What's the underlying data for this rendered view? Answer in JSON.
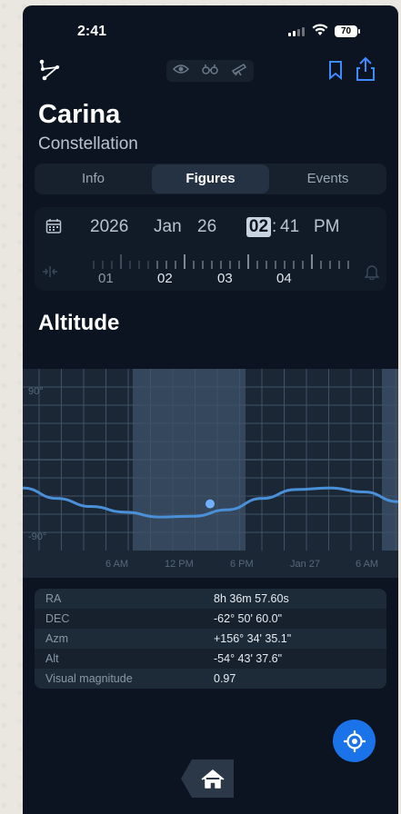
{
  "status": {
    "time": "2:41",
    "battery": "70"
  },
  "object": {
    "name": "Carina",
    "type": "Constellation"
  },
  "view_modes": [
    "eye-icon",
    "binoculars-icon",
    "telescope-icon"
  ],
  "tabs": [
    {
      "label": "Info",
      "active": false
    },
    {
      "label": "Figures",
      "active": true
    },
    {
      "label": "Events",
      "active": false
    }
  ],
  "datetime": {
    "year": "2026",
    "month": "Jan",
    "day": "26",
    "hour": "02",
    "minute": "41",
    "ampm": "PM"
  },
  "hour_ruler": [
    "01",
    "02",
    "03",
    "04"
  ],
  "altitude": {
    "title": "Altitude",
    "y_labels": [
      "90°",
      "-90°"
    ],
    "x_labels": [
      "6 AM",
      "12 PM",
      "6 PM",
      "Jan 27",
      "6 AM"
    ]
  },
  "chart_data": {
    "type": "line",
    "title": "Altitude",
    "series": [
      {
        "values": [
          -35,
          -48,
          -58,
          -65,
          -71,
          -70,
          -62,
          -48,
          -37,
          -35,
          -40,
          -52
        ]
      }
    ],
    "current_point": {
      "altitude": -54.7
    },
    "y_labels": [
      "90°",
      "-90°"
    ],
    "ylim": [
      -90,
      90
    ]
  },
  "coords": [
    {
      "label": "RA",
      "value": "8h 36m 57.60s"
    },
    {
      "label": "DEC",
      "value": "-62° 50' 60.0\""
    },
    {
      "label": "Azm",
      "value": "+156° 34' 35.1\""
    },
    {
      "label": "Alt",
      "value": "-54° 43' 37.6\""
    },
    {
      "label": "Visual magnitude",
      "value": "0.97"
    }
  ],
  "colors": {
    "accent": "#1a73e8",
    "background": "#0b1420",
    "curve": "#4a90d9"
  }
}
